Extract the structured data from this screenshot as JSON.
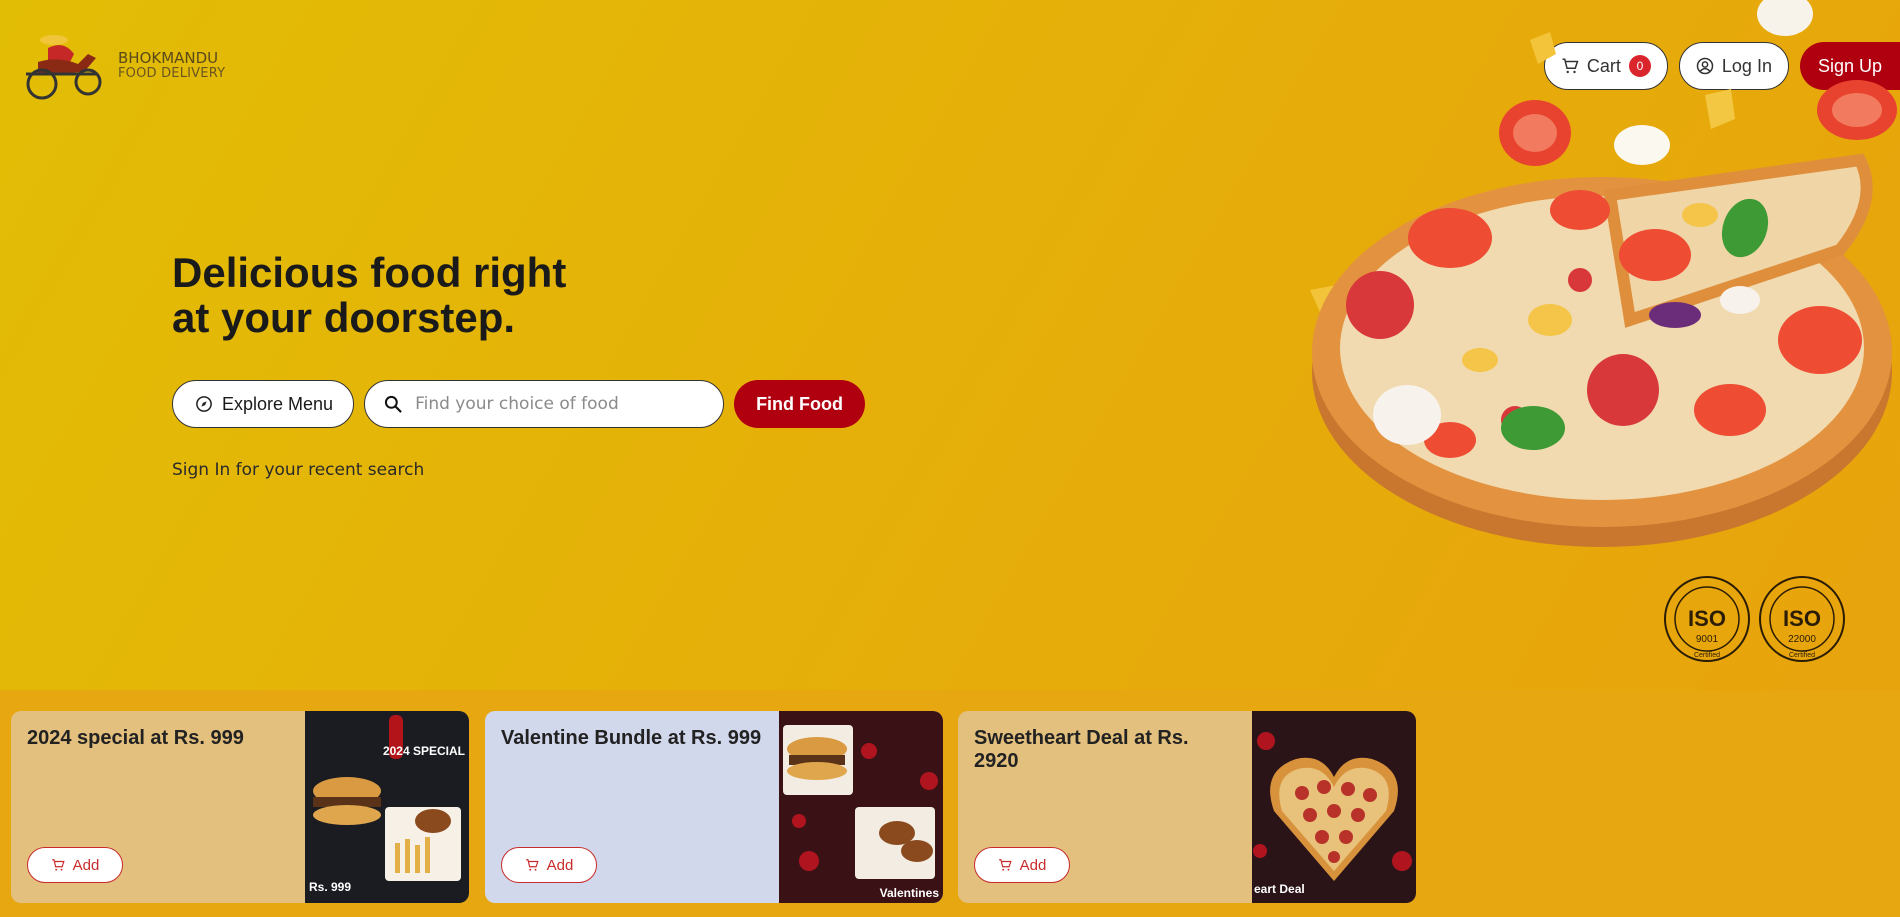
{
  "brand": {
    "line1": "BHOKMANDU",
    "line2": "FOOD DELIVERY"
  },
  "nav": {
    "cart_label": "Cart",
    "cart_count": "0",
    "login_label": "Log In",
    "signup_label": "Sign Up"
  },
  "hero": {
    "title_line1": "Delicious food right",
    "title_line2": "at your doorstep.",
    "explore_label": "Explore Menu",
    "search_placeholder": "Find your choice of food",
    "find_label": "Find Food",
    "hint": "Sign In for your recent search"
  },
  "badges": [
    {
      "text": "ISO",
      "number": "9001",
      "caption": "Certified"
    },
    {
      "text": "ISO",
      "number": "22000",
      "caption": "Certified"
    }
  ],
  "offers": [
    {
      "title": "2024 special at Rs. 999",
      "add_label": "Add",
      "bg": "#e3c07e",
      "img_text": "2024 SPECIAL",
      "price_tag": "Rs. 999"
    },
    {
      "title": "Valentine Bundle at Rs. 999",
      "add_label": "Add",
      "bg": "#d2d8ec",
      "img_text": "Valentines"
    },
    {
      "title": "Sweetheart Deal at Rs. 2920",
      "add_label": "Add",
      "bg": "#e3c07e",
      "img_text": "eart Deal"
    }
  ],
  "colors": {
    "accent": "#b00010",
    "hero_bg": "#e4b508",
    "strip_bg": "#e7a710"
  }
}
